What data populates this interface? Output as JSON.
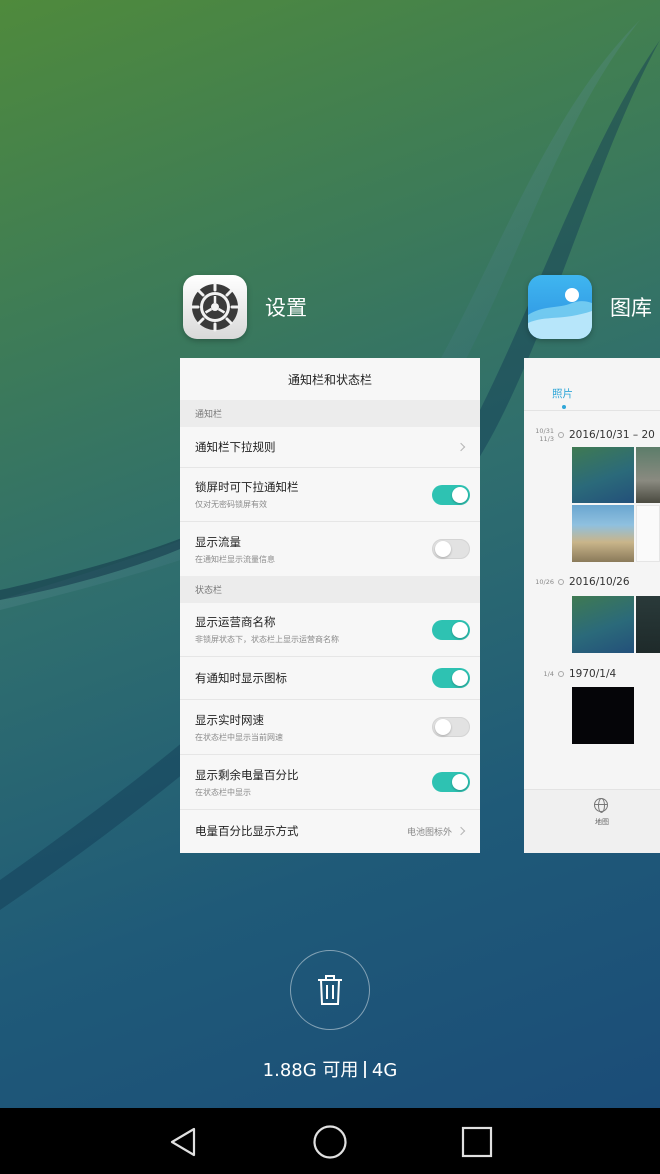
{
  "recents": {
    "settings": {
      "app_name": "设置",
      "icon": "settings-gear-icon",
      "title": "通知栏和状态栏",
      "sections": [
        {
          "label": "通知栏",
          "rows": [
            {
              "title": "通知栏下拉规则",
              "sub": "",
              "control": "chevron"
            },
            {
              "title": "锁屏时可下拉通知栏",
              "sub": "仅对无密码锁屏有效",
              "control": "toggle",
              "on": true
            },
            {
              "title": "显示流量",
              "sub": "在通知栏显示流量信息",
              "control": "toggle",
              "on": false
            }
          ]
        },
        {
          "label": "状态栏",
          "rows": [
            {
              "title": "显示运营商名称",
              "sub": "非锁屏状态下，状态栏上显示运营商名称",
              "control": "toggle",
              "on": true
            },
            {
              "title": "有通知时显示图标",
              "sub": "",
              "control": "toggle",
              "on": true
            },
            {
              "title": "显示实时网速",
              "sub": "在状态栏中显示当前网速",
              "control": "toggle",
              "on": false
            },
            {
              "title": "显示剩余电量百分比",
              "sub": "在状态栏中显示",
              "control": "toggle",
              "on": true
            },
            {
              "title": "电量百分比显示方式",
              "sub": "",
              "control": "chevron",
              "value": "电池图标外"
            }
          ]
        }
      ]
    },
    "gallery": {
      "app_name": "图库",
      "icon": "gallery-icon",
      "tab": "照片",
      "groups": [
        {
          "side": "10/31\n11/3",
          "date": "2016/10/31 – 20"
        },
        {
          "side": "10/26",
          "date": "2016/10/26"
        },
        {
          "side": "1/4",
          "date": "1970/1/4"
        }
      ],
      "bottom_tab": "地图"
    }
  },
  "memory": {
    "available": "1.88G 可用",
    "network": "4G"
  },
  "navbar": {
    "back": "back-icon",
    "home": "home-icon",
    "recents": "recents-icon"
  },
  "colors": {
    "toggle_on": "#2ec2b2",
    "accent": "#2fa6d8"
  }
}
